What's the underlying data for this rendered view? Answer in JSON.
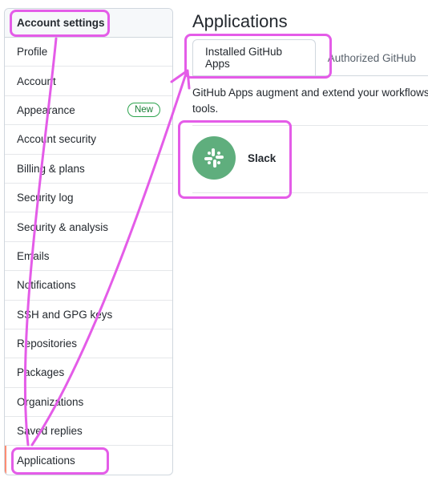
{
  "sidebar": {
    "header": "Account settings",
    "items": [
      {
        "label": "Profile"
      },
      {
        "label": "Account"
      },
      {
        "label": "Appearance",
        "badge": "New"
      },
      {
        "label": "Account security"
      },
      {
        "label": "Billing & plans"
      },
      {
        "label": "Security log"
      },
      {
        "label": "Security & analysis"
      },
      {
        "label": "Emails"
      },
      {
        "label": "Notifications"
      },
      {
        "label": "SSH and GPG keys"
      },
      {
        "label": "Repositories"
      },
      {
        "label": "Packages"
      },
      {
        "label": "Organizations"
      },
      {
        "label": "Saved replies"
      },
      {
        "label": "Applications",
        "active": true
      }
    ]
  },
  "main": {
    "title": "Applications",
    "tabs": [
      {
        "label": "Installed GitHub Apps",
        "selected": true
      },
      {
        "label": "Authorized GitHub"
      }
    ],
    "description": "GitHub Apps augment and extend your workflows tools.",
    "apps": [
      {
        "name": "Slack",
        "icon": "slack-icon",
        "icon_bg": "#5fae7d"
      }
    ]
  },
  "colors": {
    "highlight": "#e45ce8",
    "active_indicator": "#fd8c73",
    "badge": "#1a7f37"
  }
}
